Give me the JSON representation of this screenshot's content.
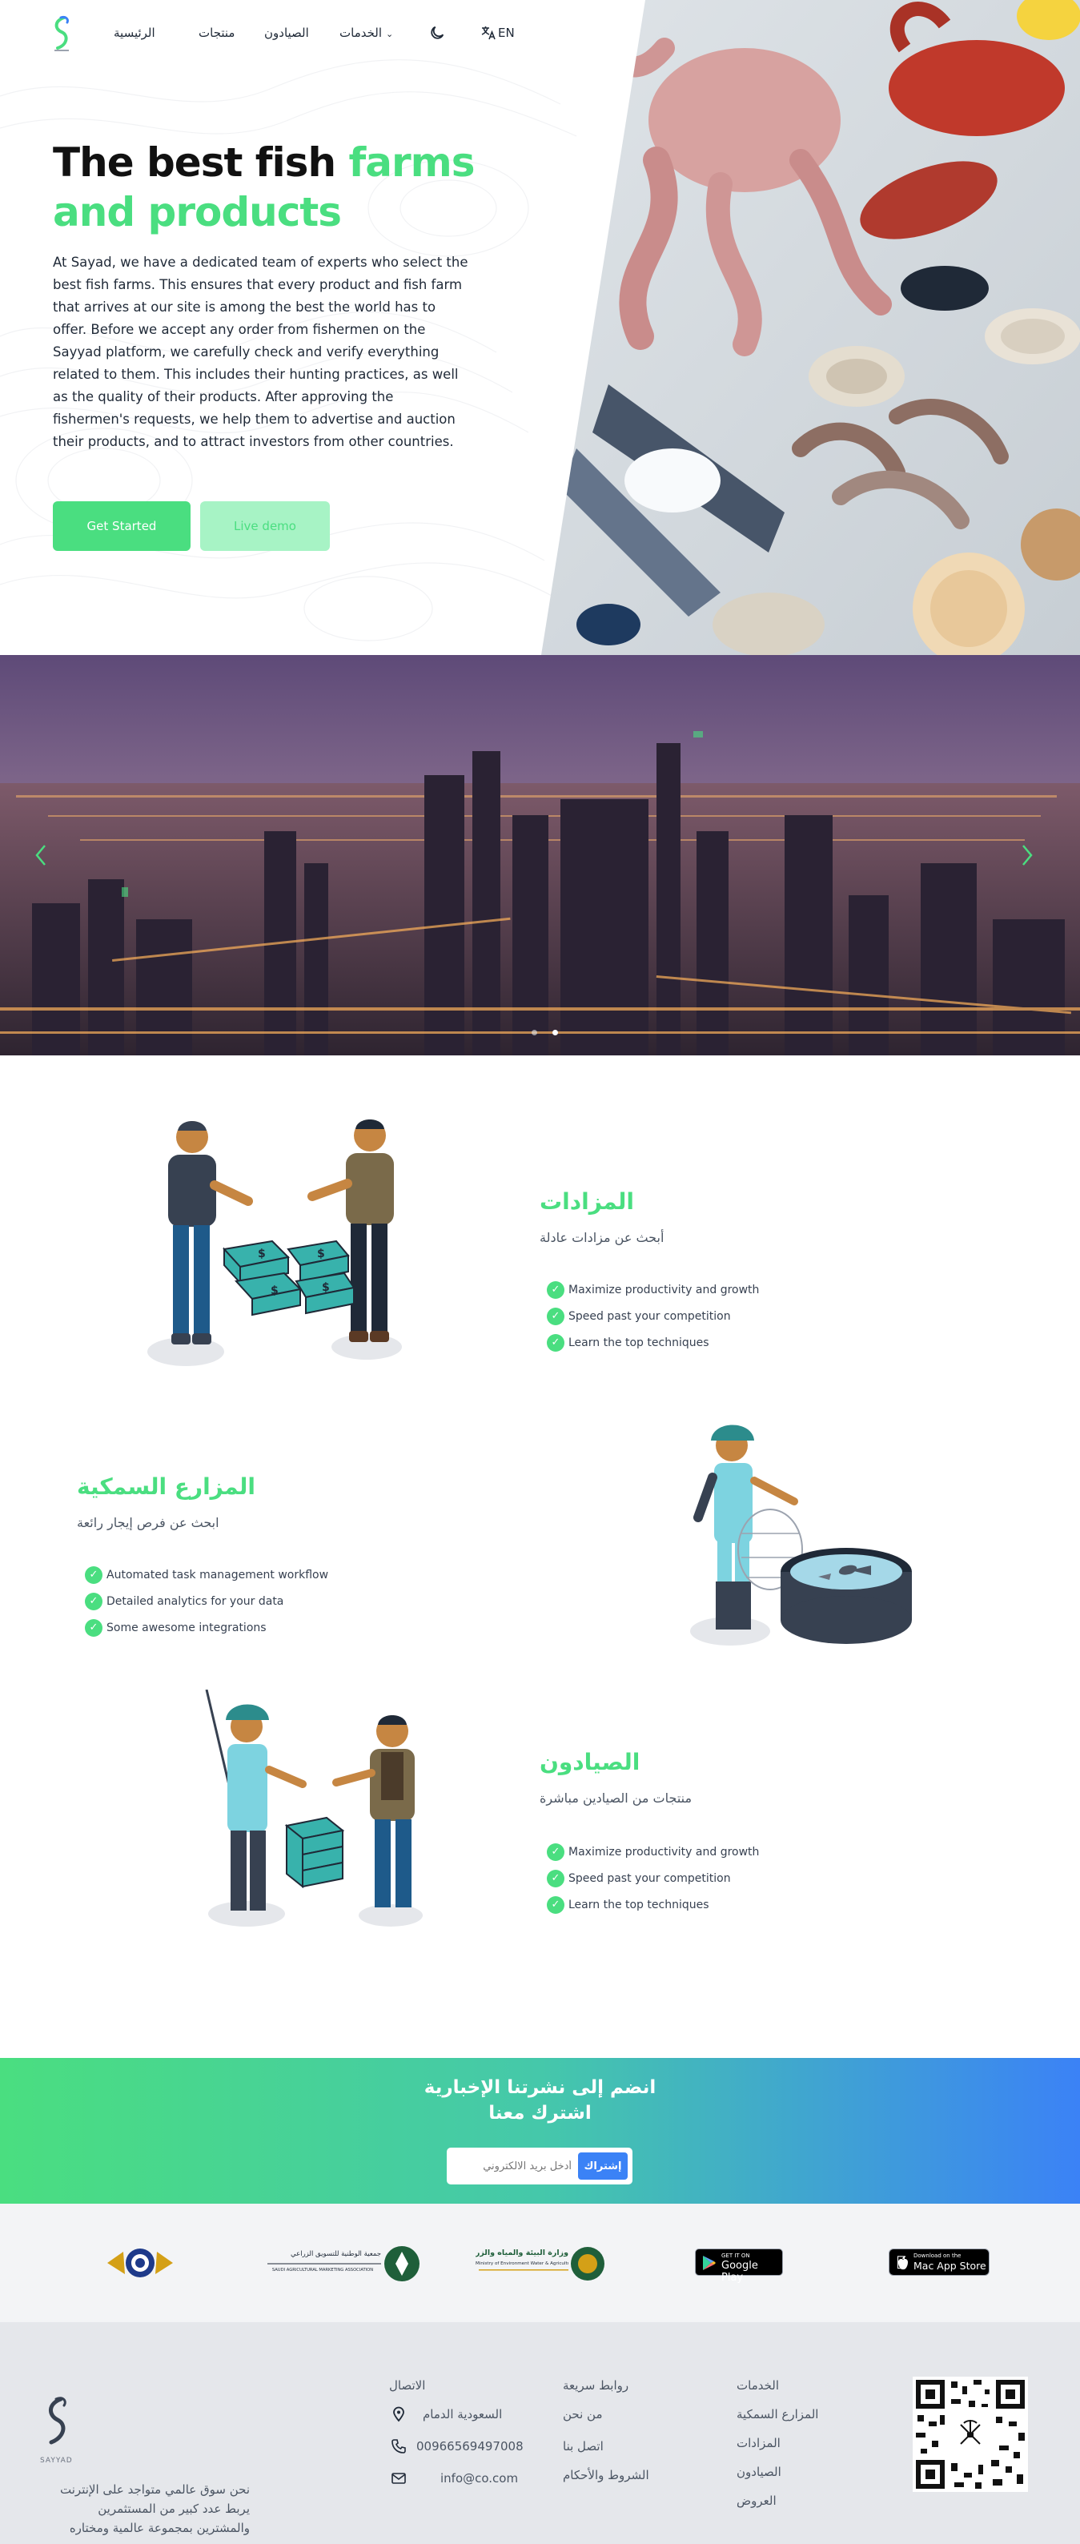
{
  "nav": {
    "home": "الرئيسية",
    "products": "منتجات",
    "fishermen": "الصيادون",
    "services": "الخدمات",
    "language": "EN"
  },
  "hero": {
    "title_plain": "The best fish ",
    "title_accent_1": "farms",
    "title_accent_2": "and products",
    "description": "At Sayad, we have a dedicated team of experts who select the best fish farms. This ensures that every product and fish farm that arrives at our site is among the best the world has to offer. Before we accept any order from fishermen on the Sayyad platform, we carefully check and verify everything related to them. This includes their hunting practices, as well as the quality of their products. After approving the fishermen's requests, we help them to advertise and auction their products, and to attract investors from other countries.",
    "primary_button": "Get Started",
    "secondary_button": "Live demo"
  },
  "carousel": {
    "slides": 2,
    "active_slide": 2
  },
  "features": [
    {
      "title": "المزادات",
      "subtitle": "أبحث عن مزادات عادلة",
      "items": [
        "Maximize productivity and growth",
        "Speed past your competition",
        "Learn the top techniques"
      ]
    },
    {
      "title": "المزارع السمكية",
      "subtitle": "ابحث عن فرص إيجار رائعة",
      "items": [
        "Automated task management workflow",
        "Detailed analytics for your data",
        "Some awesome integrations"
      ]
    },
    {
      "title": "الصيادون",
      "subtitle": "منتجات من الصيادين مباشرة",
      "items": [
        "Maximize productivity and growth",
        "Speed past your competition",
        "Learn the top techniques"
      ]
    }
  ],
  "newsletter": {
    "title_line_1": "انضم إلى نشرتنا الإخبارية",
    "title_line_2": "اشترك معنا",
    "input_placeholder": "أدخل بريد الالكتروني",
    "button": "إشتراك"
  },
  "partners": {
    "mewa_ar": "وزارة البيئة والمياه والزراعة",
    "mewa_en": "Ministry of Environment Water & Agriculture",
    "marketing_ar": "جمعية الوطنية للتسويق الزراعي",
    "marketing_en": "SAUDI AGRICULTURAL MARKETING ASSOCIATION",
    "google_play_top": "GET IT ON",
    "google_play": "Google Play",
    "app_store_top": "Download on the",
    "app_store": "Mac App Store"
  },
  "footer": {
    "logo_text": "SAYYAD",
    "about": "نحن سوق عالمي متواجد على الإنترنت يربط عدد كبير من المستثمرين والمشترين بمجموعة عالمية ومختاره",
    "contact": {
      "heading": "الاتصال",
      "location": "السعودية الدمام",
      "phone": "00966569497008",
      "email": "info@co.com"
    },
    "quick_links": {
      "heading": "روابط سريعة",
      "items": [
        "من نحن",
        "اتصل بنا",
        "الشروط والأحكام"
      ]
    },
    "services": {
      "heading": "الخدمات",
      "items": [
        "المزارع السمكية",
        "المزادات",
        "الصيادون",
        "العروض"
      ]
    }
  },
  "colors": {
    "accent": "#4ade80",
    "blue": "#3b82f6",
    "footer_bg": "#e5e7eb"
  }
}
